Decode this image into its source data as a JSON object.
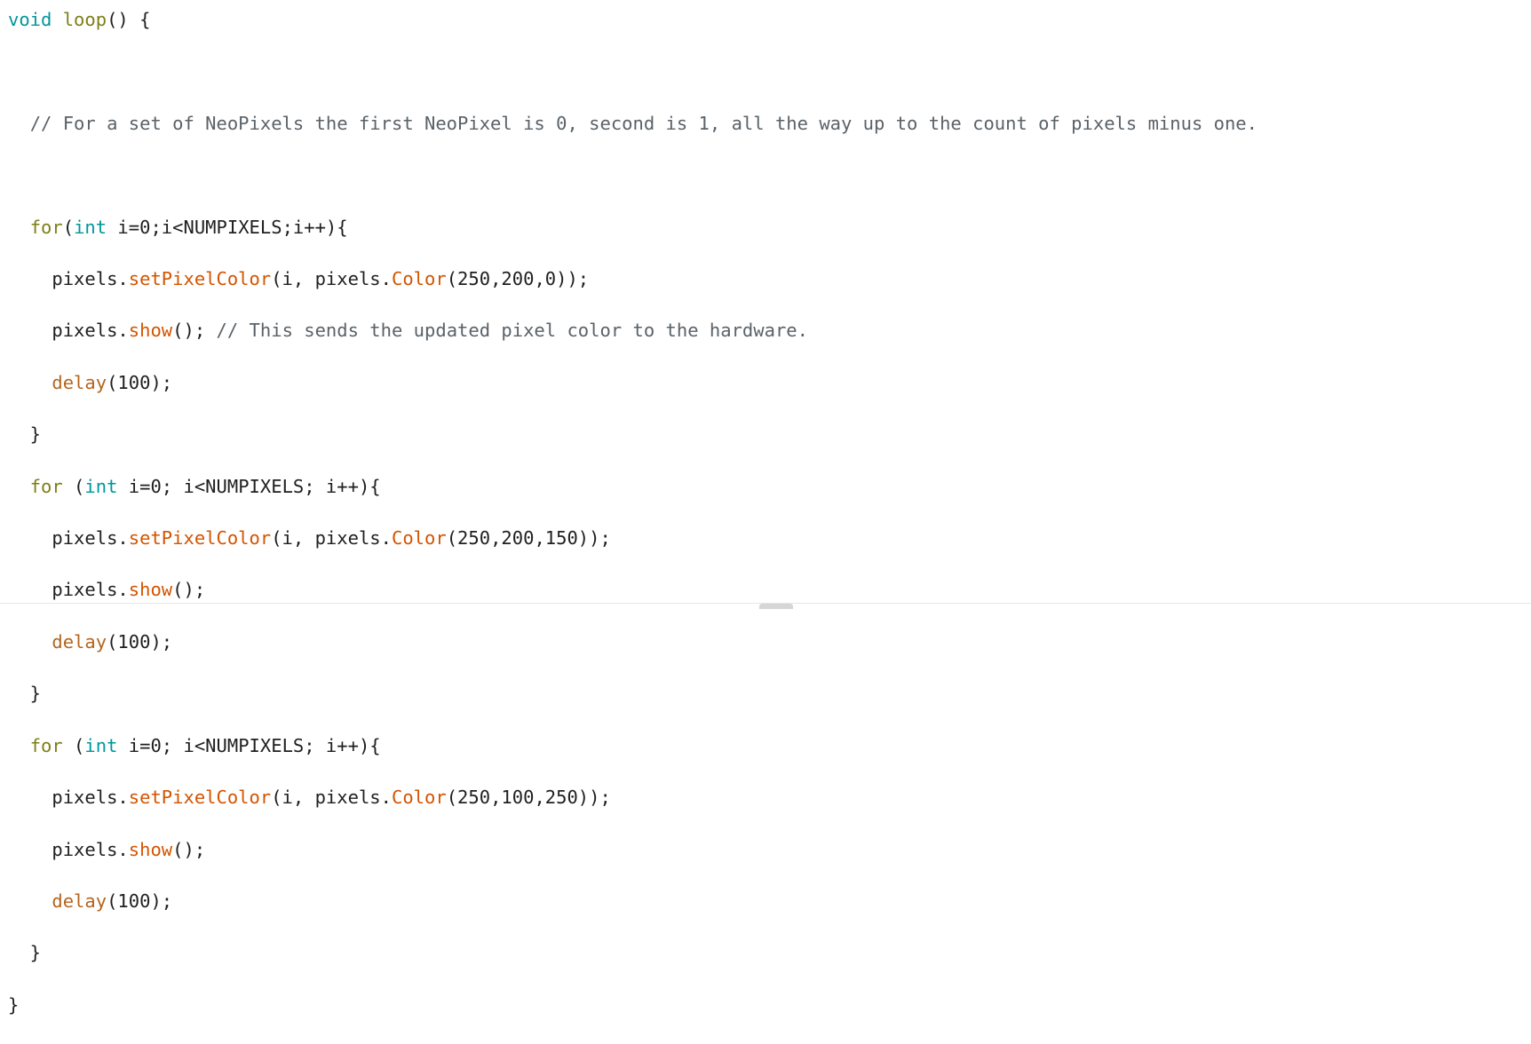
{
  "code_block": {
    "language": "arduino-cpp",
    "background_color": "#ffffff",
    "text_color": "#000000",
    "colors": {
      "keyword": "#00979c",
      "function": "#7e7f18",
      "method": "#d35400",
      "call": "#b5651d",
      "comment": "#5a6268",
      "divider": "#e6e6e6",
      "scrollbar": "#cfcfcf"
    },
    "lines": [
      {
        "id": "line-1",
        "tokens": [
          {
            "t": "void",
            "c": "kw"
          },
          {
            "t": " ",
            "c": "plain"
          },
          {
            "t": "loop",
            "c": "fn"
          },
          {
            "t": "() {",
            "c": "plain"
          }
        ]
      },
      {
        "id": "line-2",
        "tokens": [
          {
            "t": "",
            "c": "plain"
          }
        ]
      },
      {
        "id": "line-3",
        "tokens": [
          {
            "t": "  ",
            "c": "plain"
          },
          {
            "t": "// For a set of NeoPixels the first NeoPixel is 0, second is 1, all the way up to the count of pixels minus one.",
            "c": "comment"
          }
        ]
      },
      {
        "id": "line-4",
        "tokens": [
          {
            "t": "",
            "c": "plain"
          }
        ]
      },
      {
        "id": "line-5",
        "tokens": [
          {
            "t": "  ",
            "c": "plain"
          },
          {
            "t": "for",
            "c": "fn"
          },
          {
            "t": "(",
            "c": "plain"
          },
          {
            "t": "int",
            "c": "kw"
          },
          {
            "t": " i=0;i<NUMPIXELS;i++){",
            "c": "plain"
          }
        ]
      },
      {
        "id": "line-6",
        "tokens": [
          {
            "t": "    pixels.",
            "c": "plain"
          },
          {
            "t": "setPixelColor",
            "c": "method"
          },
          {
            "t": "(i, pixels.",
            "c": "plain"
          },
          {
            "t": "Color",
            "c": "method"
          },
          {
            "t": "(250,200,0));",
            "c": "plain"
          }
        ]
      },
      {
        "id": "line-7",
        "tokens": [
          {
            "t": "    pixels.",
            "c": "plain"
          },
          {
            "t": "show",
            "c": "method"
          },
          {
            "t": "(); ",
            "c": "plain"
          },
          {
            "t": "// This sends the updated pixel color to the hardware.",
            "c": "comment"
          }
        ]
      },
      {
        "id": "line-8",
        "tokens": [
          {
            "t": "    ",
            "c": "plain"
          },
          {
            "t": "delay",
            "c": "call"
          },
          {
            "t": "(100);",
            "c": "plain"
          }
        ]
      },
      {
        "id": "line-9",
        "tokens": [
          {
            "t": "  }",
            "c": "plain"
          }
        ]
      },
      {
        "id": "line-10",
        "tokens": [
          {
            "t": "  ",
            "c": "plain"
          },
          {
            "t": "for",
            "c": "fn"
          },
          {
            "t": " (",
            "c": "plain"
          },
          {
            "t": "int",
            "c": "kw"
          },
          {
            "t": " i=0; i<NUMPIXELS; i++){",
            "c": "plain"
          }
        ]
      },
      {
        "id": "line-11",
        "tokens": [
          {
            "t": "    pixels.",
            "c": "plain"
          },
          {
            "t": "setPixelColor",
            "c": "method"
          },
          {
            "t": "(i, pixels.",
            "c": "plain"
          },
          {
            "t": "Color",
            "c": "method"
          },
          {
            "t": "(250,200,150));",
            "c": "plain"
          }
        ]
      },
      {
        "id": "line-12",
        "tokens": [
          {
            "t": "    pixels.",
            "c": "plain"
          },
          {
            "t": "show",
            "c": "method"
          },
          {
            "t": "();",
            "c": "plain"
          }
        ]
      },
      {
        "id": "line-13",
        "tokens": [
          {
            "t": "    ",
            "c": "plain"
          },
          {
            "t": "delay",
            "c": "call"
          },
          {
            "t": "(100);",
            "c": "plain"
          }
        ]
      },
      {
        "id": "line-14",
        "tokens": [
          {
            "t": "  }",
            "c": "plain"
          }
        ]
      },
      {
        "id": "line-15",
        "tokens": [
          {
            "t": "  ",
            "c": "plain"
          },
          {
            "t": "for",
            "c": "fn"
          },
          {
            "t": " (",
            "c": "plain"
          },
          {
            "t": "int",
            "c": "kw"
          },
          {
            "t": " i=0; i<NUMPIXELS; i++){",
            "c": "plain"
          }
        ]
      },
      {
        "id": "line-16",
        "tokens": [
          {
            "t": "    pixels.",
            "c": "plain"
          },
          {
            "t": "setPixelColor",
            "c": "method"
          },
          {
            "t": "(i, pixels.",
            "c": "plain"
          },
          {
            "t": "Color",
            "c": "method"
          },
          {
            "t": "(250,100,250));",
            "c": "plain"
          }
        ]
      },
      {
        "id": "line-17",
        "tokens": [
          {
            "t": "    pixels.",
            "c": "plain"
          },
          {
            "t": "show",
            "c": "method"
          },
          {
            "t": "();",
            "c": "plain"
          }
        ]
      },
      {
        "id": "line-18",
        "tokens": [
          {
            "t": "    ",
            "c": "plain"
          },
          {
            "t": "delay",
            "c": "call"
          },
          {
            "t": "(100);",
            "c": "plain"
          }
        ]
      },
      {
        "id": "line-19",
        "tokens": [
          {
            "t": "  }",
            "c": "plain"
          }
        ]
      },
      {
        "id": "line-20",
        "tokens": [
          {
            "t": "}",
            "c": "plain"
          }
        ]
      }
    ]
  }
}
